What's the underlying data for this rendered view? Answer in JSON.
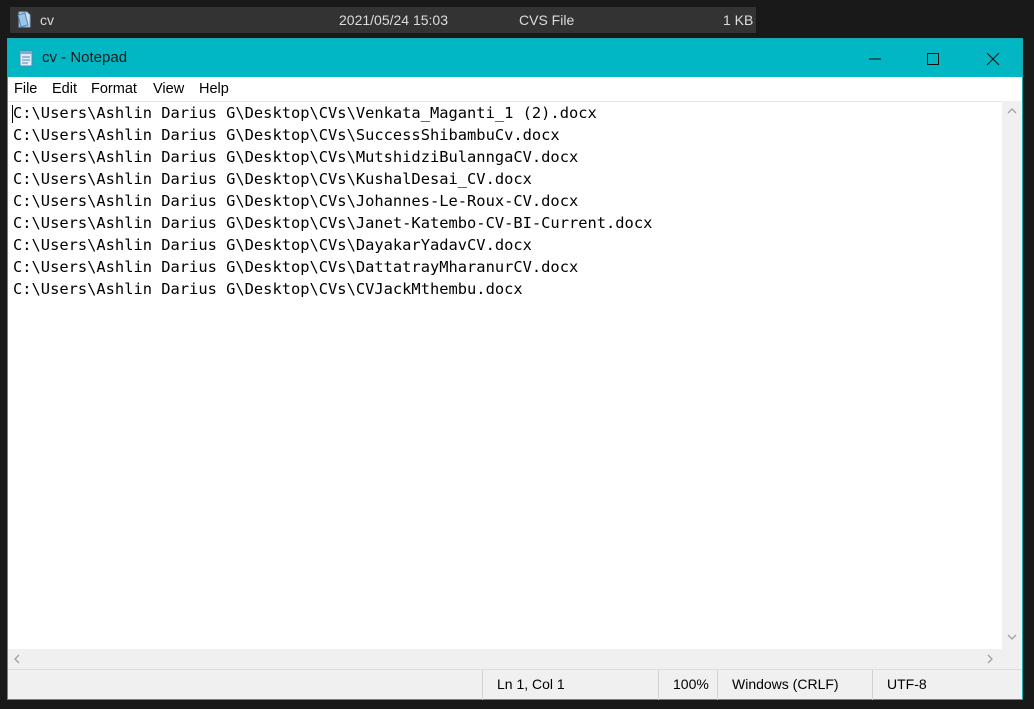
{
  "explorer": {
    "file_name": "cv",
    "date_modified": "2021/05/24 15:03",
    "file_type": "CVS File",
    "file_size": "1 KB"
  },
  "window": {
    "title": "cv - Notepad",
    "controls": [
      "minimize-icon",
      "maximize-icon",
      "close-icon"
    ]
  },
  "menu": {
    "items": [
      "File",
      "Edit",
      "Format",
      "View",
      "Help"
    ]
  },
  "editor": {
    "lines": [
      "C:\\Users\\Ashlin Darius G\\Desktop\\CVs\\Venkata_Maganti_1 (2).docx",
      "C:\\Users\\Ashlin Darius G\\Desktop\\CVs\\SuccessShibambuCv.docx",
      "C:\\Users\\Ashlin Darius G\\Desktop\\CVs\\MutshidziBulanngaCV.docx",
      "C:\\Users\\Ashlin Darius G\\Desktop\\CVs\\KushalDesai_CV.docx",
      "C:\\Users\\Ashlin Darius G\\Desktop\\CVs\\Johannes-Le-Roux-CV.docx",
      "C:\\Users\\Ashlin Darius G\\Desktop\\CVs\\Janet-Katembo-CV-BI-Current.docx",
      "C:\\Users\\Ashlin Darius G\\Desktop\\CVs\\DayakarYadavCV.docx",
      "C:\\Users\\Ashlin Darius G\\Desktop\\CVs\\DattatrayMharanurCV.docx",
      "C:\\Users\\Ashlin Darius G\\Desktop\\CVs\\CVJackMthembu.docx"
    ]
  },
  "status": {
    "position": "Ln 1, Col 1",
    "zoom": "100%",
    "line_ending": "Windows (CRLF)",
    "encoding": "UTF-8"
  },
  "colors": {
    "titlebar": "#00b7c3",
    "background": "#191919"
  }
}
